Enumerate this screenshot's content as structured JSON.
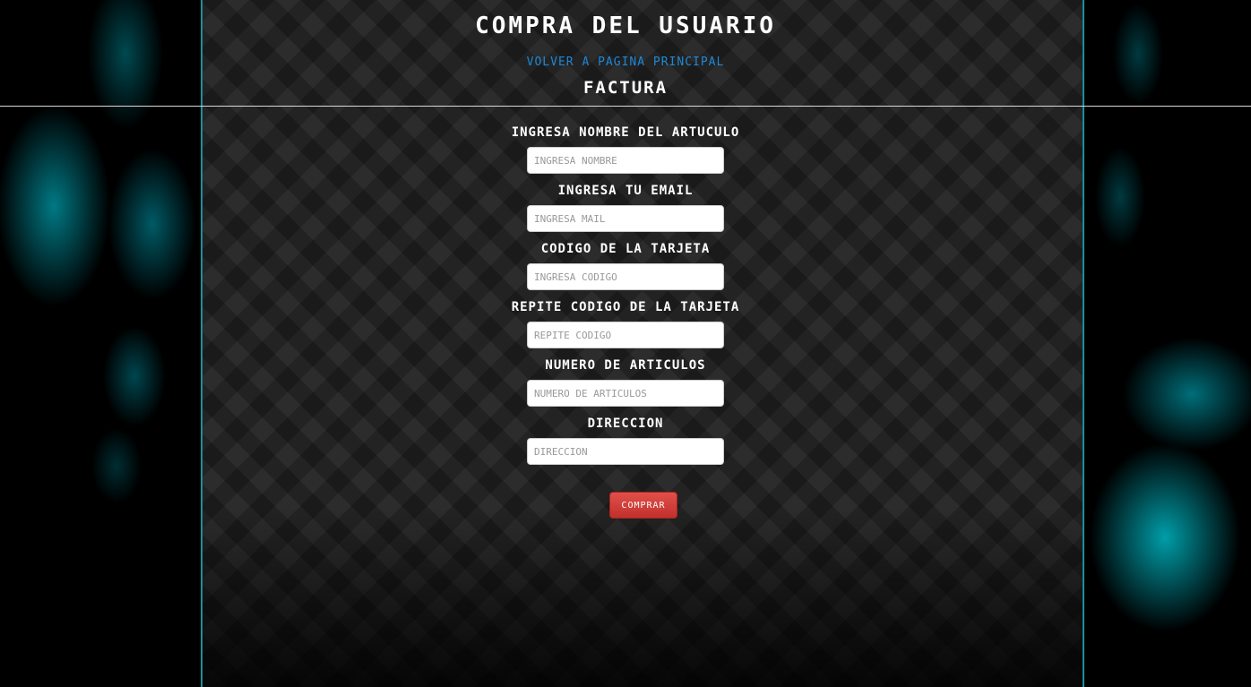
{
  "header": {
    "title": "COMPRA DEL USUARIO",
    "back_link": "VOLVER A PAGINA PRINCIPAL",
    "subtitle": "FACTURA"
  },
  "form": {
    "fields": [
      {
        "label": "INGRESA NOMBRE DEL ARTUCULO",
        "placeholder": "INGRESA NOMBRE",
        "value": ""
      },
      {
        "label": "INGRESA TU EMAIL",
        "placeholder": "INGRESA MAIL",
        "value": ""
      },
      {
        "label": "CODIGO DE LA TARJETA",
        "placeholder": "INGRESA CODIGO",
        "value": ""
      },
      {
        "label": "REPITE CODIGO DE LA TARJETA",
        "placeholder": "REPITE CODIGO",
        "value": ""
      },
      {
        "label": "NUMERO DE ARTICULOS",
        "placeholder": "NUMERO DE ARTICULOS",
        "value": ""
      },
      {
        "label": "DIRECCION",
        "placeholder": "DIRECCION",
        "value": ""
      }
    ],
    "submit_label": "COMPRAR"
  },
  "colors": {
    "accent_cyan": "#1b8fa0",
    "link_blue": "#1e88d6",
    "button_red": "#d0403a"
  }
}
